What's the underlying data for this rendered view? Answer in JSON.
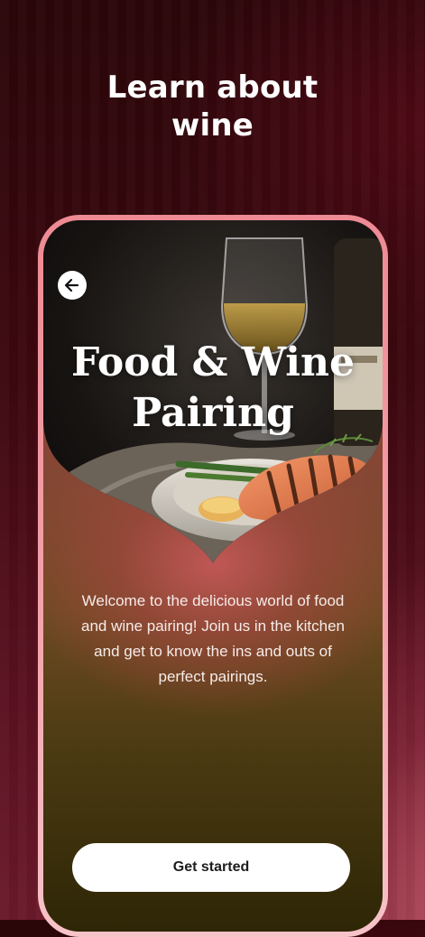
{
  "page": {
    "headline": "Learn about\nwine"
  },
  "card": {
    "back_icon": "arrow-left-icon",
    "title": "Food & Wine\nPairing",
    "intro": "Welcome to the delicious world of food and wine pairing! Join us in the kitchen and get to know the ins and outs of perfect pairings.",
    "cta_label": "Get started"
  },
  "colors": {
    "background": "#3c080f",
    "frame_pink": "#ee8a93",
    "button_bg": "#ffffff",
    "button_text": "#1d1d1d",
    "text_light": "#ffffff"
  }
}
